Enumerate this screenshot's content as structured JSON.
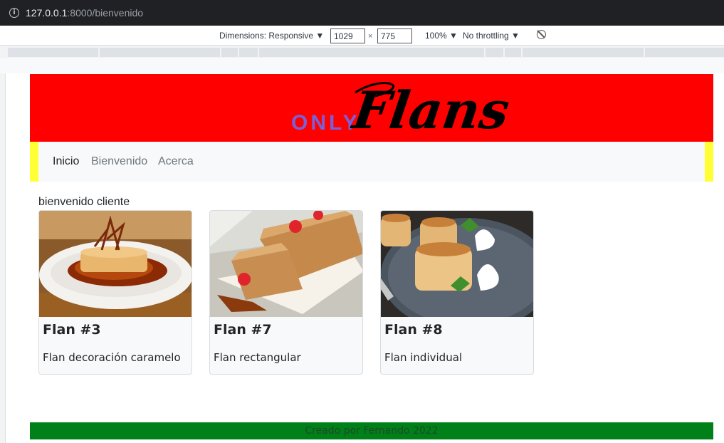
{
  "browser": {
    "url_host": "127.0.0.1",
    "url_rest": ":8000/bienvenido",
    "info_icon": "info-icon"
  },
  "devtools": {
    "dimensions_label": "Dimensions: Responsive ▼",
    "width": "1029",
    "height": "775",
    "times": "×",
    "zoom": "100% ▼",
    "throttling": "No throttling ▼",
    "rotate_icon": "rotate-icon"
  },
  "site": {
    "logo_only": "ONLY",
    "logo_flans": "Flans",
    "banner_color": "#ff0000",
    "nav_accent_color": "#ffff33"
  },
  "nav": {
    "items": [
      {
        "label": "Inicio"
      },
      {
        "label": "Bienvenido"
      },
      {
        "label": "Acerca"
      }
    ]
  },
  "greeting": "bienvenido cliente",
  "cards": [
    {
      "title": "Flan #3",
      "text": "Flan decoración caramelo",
      "image": "flan-caramel-decoration-photo"
    },
    {
      "title": "Flan #7",
      "text": "Flan rectangular",
      "image": "flan-rectangular-photo"
    },
    {
      "title": "Flan #8",
      "text": "Flan individual",
      "image": "flan-individual-photo"
    }
  ],
  "footer": {
    "text": "Creado por Fernando 2022",
    "color": "#008018"
  }
}
